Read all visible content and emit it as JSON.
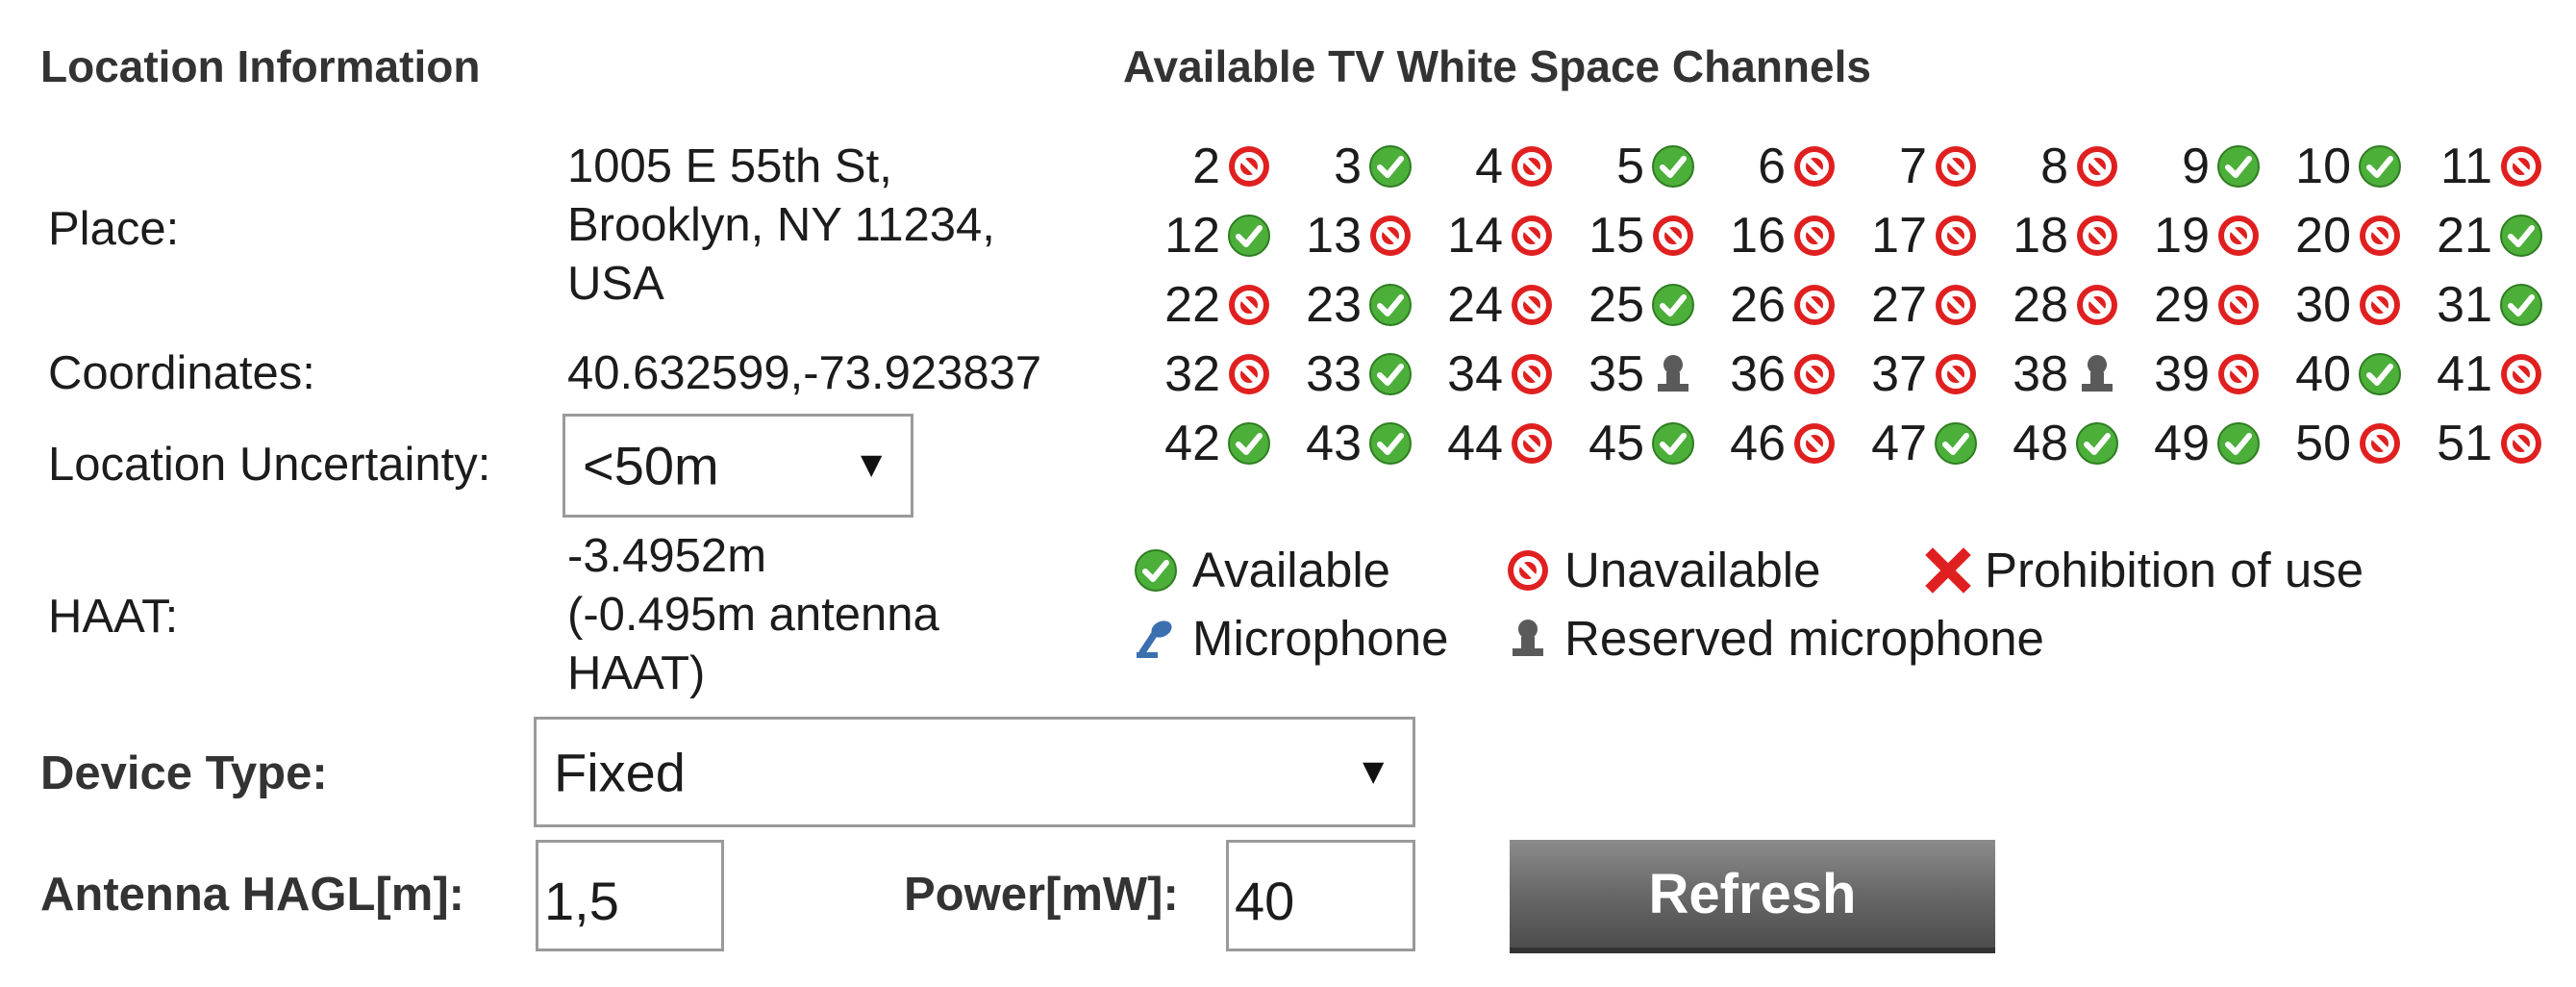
{
  "location": {
    "heading": "Location Information",
    "place_label": "Place:",
    "place_lines": [
      "1005 E 55th St,",
      "Brooklyn, NY 11234,",
      "USA"
    ],
    "coordinates_label": "Coordinates:",
    "coordinates_value": "40.632599,-73.923837",
    "uncertainty_label": "Location Uncertainty:",
    "uncertainty_value": "<50m",
    "haat_label": "HAAT:",
    "haat_lines": [
      "-3.4952m",
      "(-0.495m antenna",
      "HAAT)"
    ]
  },
  "device": {
    "type_label": "Device Type:",
    "type_value": "Fixed",
    "hagl_label": "Antenna HAGL[m]:",
    "hagl_value": "1,5",
    "power_label": "Power[mW]:",
    "power_value": "40",
    "refresh_label": "Refresh"
  },
  "channels": {
    "heading": "Available TV White Space Channels",
    "list": [
      {
        "ch": "2",
        "status": "unavailable"
      },
      {
        "ch": "3",
        "status": "available"
      },
      {
        "ch": "4",
        "status": "unavailable"
      },
      {
        "ch": "5",
        "status": "available"
      },
      {
        "ch": "6",
        "status": "unavailable"
      },
      {
        "ch": "7",
        "status": "unavailable"
      },
      {
        "ch": "8",
        "status": "unavailable"
      },
      {
        "ch": "9",
        "status": "available"
      },
      {
        "ch": "10",
        "status": "available"
      },
      {
        "ch": "11",
        "status": "unavailable"
      },
      {
        "ch": "12",
        "status": "available"
      },
      {
        "ch": "13",
        "status": "unavailable"
      },
      {
        "ch": "14",
        "status": "unavailable"
      },
      {
        "ch": "15",
        "status": "unavailable"
      },
      {
        "ch": "16",
        "status": "unavailable"
      },
      {
        "ch": "17",
        "status": "unavailable"
      },
      {
        "ch": "18",
        "status": "unavailable"
      },
      {
        "ch": "19",
        "status": "unavailable"
      },
      {
        "ch": "20",
        "status": "unavailable"
      },
      {
        "ch": "21",
        "status": "available"
      },
      {
        "ch": "22",
        "status": "unavailable"
      },
      {
        "ch": "23",
        "status": "available"
      },
      {
        "ch": "24",
        "status": "unavailable"
      },
      {
        "ch": "25",
        "status": "available"
      },
      {
        "ch": "26",
        "status": "unavailable"
      },
      {
        "ch": "27",
        "status": "unavailable"
      },
      {
        "ch": "28",
        "status": "unavailable"
      },
      {
        "ch": "29",
        "status": "unavailable"
      },
      {
        "ch": "30",
        "status": "unavailable"
      },
      {
        "ch": "31",
        "status": "available"
      },
      {
        "ch": "32",
        "status": "unavailable"
      },
      {
        "ch": "33",
        "status": "available"
      },
      {
        "ch": "34",
        "status": "unavailable"
      },
      {
        "ch": "35",
        "status": "reserved-microphone"
      },
      {
        "ch": "36",
        "status": "unavailable"
      },
      {
        "ch": "37",
        "status": "unavailable"
      },
      {
        "ch": "38",
        "status": "reserved-microphone"
      },
      {
        "ch": "39",
        "status": "unavailable"
      },
      {
        "ch": "40",
        "status": "available"
      },
      {
        "ch": "41",
        "status": "unavailable"
      },
      {
        "ch": "42",
        "status": "available"
      },
      {
        "ch": "43",
        "status": "available"
      },
      {
        "ch": "44",
        "status": "unavailable"
      },
      {
        "ch": "45",
        "status": "available"
      },
      {
        "ch": "46",
        "status": "unavailable"
      },
      {
        "ch": "47",
        "status": "available"
      },
      {
        "ch": "48",
        "status": "available"
      },
      {
        "ch": "49",
        "status": "available"
      },
      {
        "ch": "50",
        "status": "unavailable"
      },
      {
        "ch": "51",
        "status": "unavailable"
      }
    ]
  },
  "legend": {
    "available": "Available",
    "unavailable": "Unavailable",
    "prohibition": "Prohibition of use",
    "microphone": "Microphone",
    "reserved_microphone": "Reserved microphone"
  },
  "colors": {
    "available_green": "#4caf3a",
    "unavailable_red": "#e02020",
    "reserved_gray": "#5a5a5a",
    "microphone_blue": "#3a6fb0"
  }
}
